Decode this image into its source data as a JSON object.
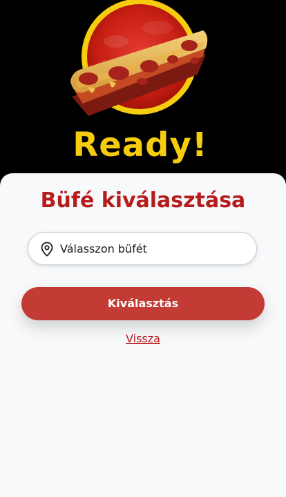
{
  "brand": {
    "word": "Ready!",
    "logo_icon": "pizza-slice-logo",
    "accent_yellow": "#f6cd0e",
    "accent_red": "#c62828"
  },
  "card": {
    "title": "Büfé kiválasztása",
    "title_color": "#b71c1c",
    "background": "#f7f9fb"
  },
  "select": {
    "icon": "location-pin-icon",
    "placeholder": "Válasszon büfét"
  },
  "actions": {
    "submit_label": "Kiválasztás",
    "submit_color": "#c23b35",
    "back_label": "Vissza"
  }
}
